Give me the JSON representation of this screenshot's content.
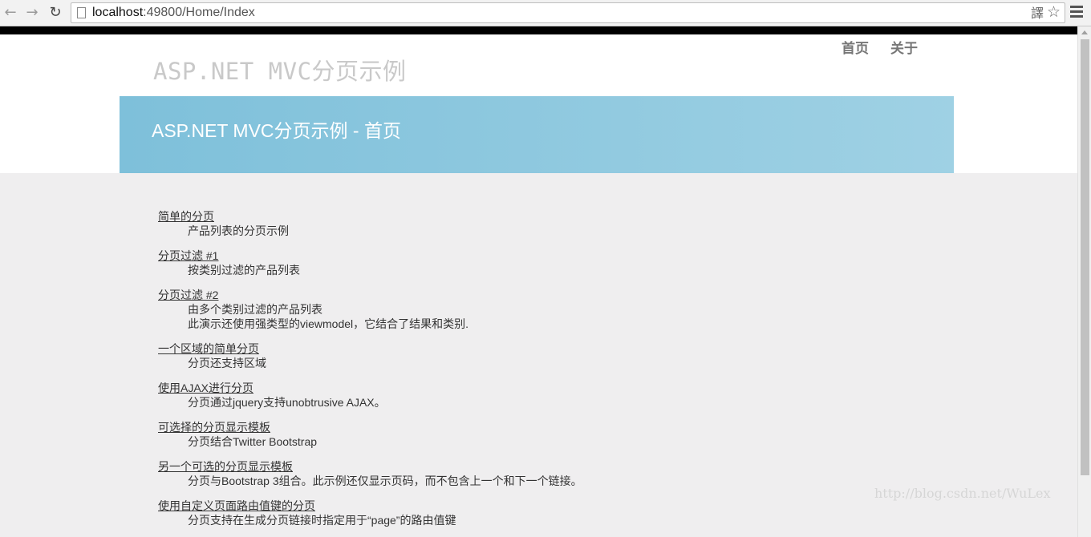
{
  "browser": {
    "url_host": "localhost",
    "url_path": ":49800/Home/Index",
    "back_icon": "←",
    "forward_icon": "→",
    "reload_icon": "↻",
    "translate_icon": "譯",
    "star_icon": "☆"
  },
  "header": {
    "site_title": "ASP.NET MVC分页示例",
    "nav": [
      {
        "label": "首页"
      },
      {
        "label": "关于"
      }
    ]
  },
  "featured": {
    "title": "ASP.NET MVC分页示例 - 首页"
  },
  "examples": [
    {
      "link": "简单的分页",
      "desc": [
        "产品列表的分页示例"
      ]
    },
    {
      "link": "分页过滤 #1",
      "desc": [
        "按类别过滤的产品列表"
      ]
    },
    {
      "link": "分页过滤 #2",
      "desc": [
        "由多个类别过滤的产品列表",
        "此演示还使用强类型的viewmodel，它结合了结果和类别."
      ]
    },
    {
      "link": "一个区域的简单分页",
      "desc": [
        "分页还支持区域"
      ]
    },
    {
      "link": "使用AJAX进行分页",
      "desc": [
        "分页通过jquery支持unobtrusive AJAX。"
      ]
    },
    {
      "link": "可选择的分页显示模板",
      "desc": [
        "分页结合Twitter Bootstrap"
      ]
    },
    {
      "link": "另一个可选的分页显示模板",
      "desc": [
        "分页与Bootstrap 3组合。此示例还仅显示页码，而不包含上一个和下一个链接。"
      ]
    },
    {
      "link": "使用自定义页面路由值键的分页",
      "desc": [
        "分页支持在生成分页链接时指定用于“page”的路由值键"
      ]
    }
  ],
  "watermark": "http://blog.csdn.net/WuLex"
}
